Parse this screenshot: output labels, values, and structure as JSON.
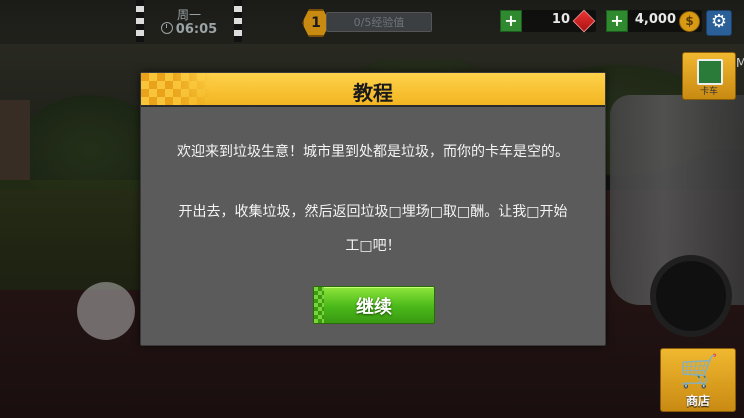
{
  "hud": {
    "day": "周一",
    "time": "06:05",
    "level": "1",
    "xp_text": "0/5经验值",
    "gems": "10",
    "coins": "4,000",
    "coin_symbol": "$",
    "plus": "+",
    "settings_icon": "gear-icon",
    "side_letter": "M"
  },
  "side_buttons": {
    "truck_label": "卡车",
    "shop_label": "商店"
  },
  "dialog": {
    "title": "教程",
    "line1": "欢迎来到垃圾生意！城市里到处都是垃圾，而你的卡车是空的。",
    "line2": "开出去，收集垃圾，然后返回垃圾□埋场□取□酬。让我□开始",
    "line3": "工□吧！",
    "continue_label": "继续"
  },
  "colors": {
    "header_yellow": "#f2b522",
    "continue_green": "#4ab81a",
    "dialog_gray": "#5b5b5b",
    "shop_orange": "#e0a020"
  }
}
